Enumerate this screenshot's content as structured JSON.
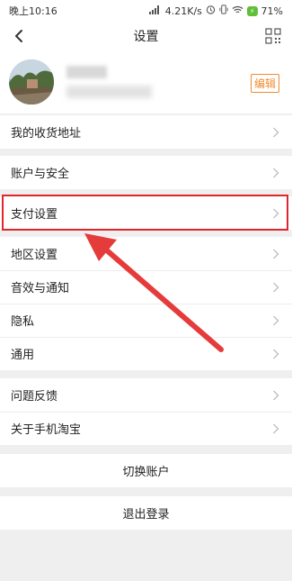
{
  "status": {
    "time": "晚上10:16",
    "speed": "4.21K/s",
    "battery": "71%"
  },
  "header": {
    "title": "设置"
  },
  "profile": {
    "edit_label": "编辑"
  },
  "menu": {
    "address": "我的收货地址",
    "account_security": "账户与安全",
    "payment": "支付设置",
    "region": "地区设置",
    "sound": "音效与通知",
    "privacy": "隐私",
    "general": "通用",
    "feedback": "问题反馈",
    "about": "关于手机淘宝"
  },
  "actions": {
    "switch_account": "切换账户",
    "logout": "退出登录"
  },
  "colors": {
    "accent": "#f28a2c",
    "highlight": "#e0262b",
    "arrow": "#e53b3b"
  }
}
